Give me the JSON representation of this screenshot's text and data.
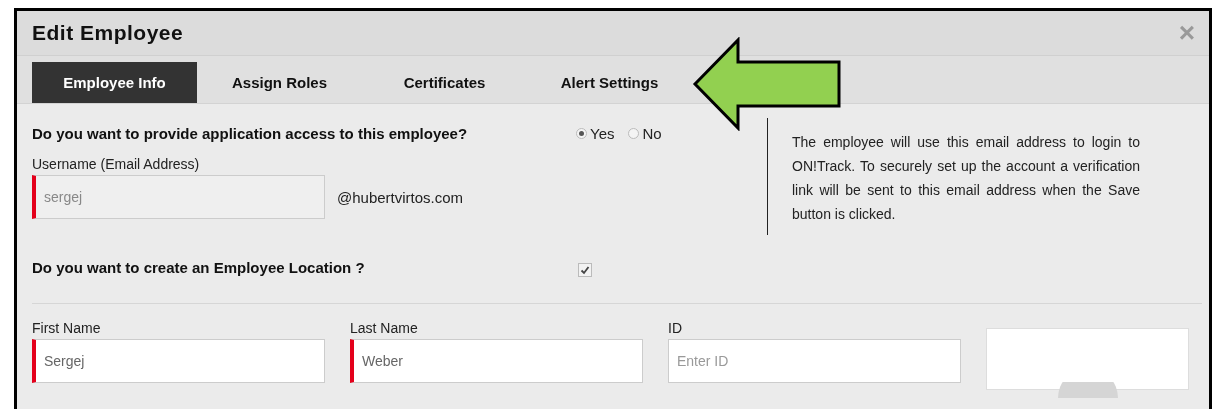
{
  "window": {
    "title": "Edit Employee",
    "close": "×"
  },
  "tabs": [
    {
      "label": "Employee Info",
      "selected": true
    },
    {
      "label": "Assign Roles",
      "selected": false
    },
    {
      "label": "Certificates",
      "selected": false
    },
    {
      "label": "Alert Settings",
      "selected": false
    }
  ],
  "access": {
    "question": "Do you want to provide application access to this employee?",
    "options": [
      {
        "label": "Yes",
        "selected": true
      },
      {
        "label": "No",
        "selected": false
      }
    ]
  },
  "username": {
    "label": "Username (Email Address)",
    "value": "sergej",
    "required": true,
    "domain": "@hubertvirtos.com"
  },
  "info": "The employee will use this email address to login to ON!Track. To securely set up the account a verification link will be sent to this email address when the Save button is clicked.",
  "location": {
    "question": "Do you want to create an Employee Location ?",
    "checked": true
  },
  "fields": [
    {
      "label": "First Name",
      "value": "Sergej",
      "required": true
    },
    {
      "label": "Last Name",
      "value": "Weber",
      "required": true
    },
    {
      "label": "ID",
      "placeholder": "Enter ID",
      "required": false
    }
  ]
}
